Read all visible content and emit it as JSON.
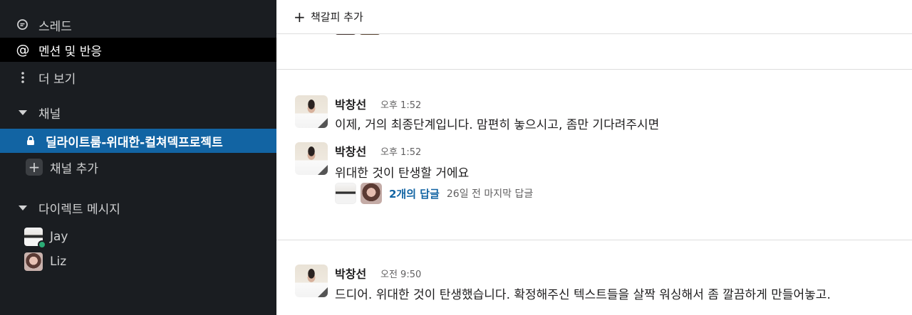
{
  "sidebar": {
    "threads_label": "스레드",
    "mentions_label": "멘션 및 반응",
    "more_label": "더 보기",
    "channels_header": "채널",
    "active_channel": "딜라이트룸-위대한-컬쳐덱프로젝트",
    "add_channel_label": "채널 추가",
    "dm_header": "다이렉트 메시지",
    "dms": [
      {
        "name": "Jay",
        "online": true
      },
      {
        "name": "Liz",
        "online": false
      }
    ]
  },
  "main": {
    "bookmark_label": "책갈피 추가",
    "messages": [
      {
        "author": "박창선",
        "time": "오후 1:52",
        "text": "이제, 거의 최종단계입니다. 맘편히 놓으시고, 좀만 기다려주시면"
      },
      {
        "author": "박창선",
        "time": "오후 1:52",
        "text": "위대한 것이 탄생할 거에요",
        "replies": {
          "count": "2개의 답글",
          "last": "26일 전 마지막 답글"
        }
      },
      {
        "author": "박창선",
        "time": "오전 9:50",
        "text": "드디어. 위대한 것이 탄생했습니다. 확정해주신 텍스트들을 살짝 워싱해서 좀 깔끔하게 만들어놓고."
      }
    ]
  },
  "colors": {
    "sidebar_bg": "#1a1d21",
    "active_channel_bg": "#1264a3",
    "link_blue": "#1264a3",
    "presence_green": "#2bac76"
  }
}
